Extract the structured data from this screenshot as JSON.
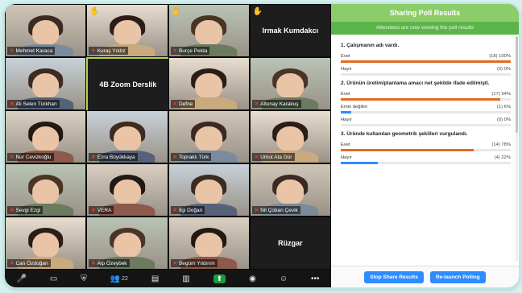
{
  "gallery": {
    "tiles": [
      {
        "name": "Mehmet Karaca",
        "muted": true,
        "hand": false,
        "kind": "video"
      },
      {
        "name": "Kuraş Yıldız",
        "muted": true,
        "hand": true,
        "kind": "video"
      },
      {
        "name": "Burçe Pelda",
        "muted": true,
        "hand": true,
        "kind": "video"
      },
      {
        "name": "Irmak Kumdakcı",
        "muted": true,
        "hand": true,
        "kind": "text"
      },
      {
        "name": "Ali Selen Türkhan",
        "muted": true,
        "hand": false,
        "kind": "video"
      },
      {
        "name": "4B Zoom Derslik",
        "muted": false,
        "hand": false,
        "kind": "text"
      },
      {
        "name": "Defne",
        "muted": true,
        "hand": false,
        "kind": "video"
      },
      {
        "name": "Altunay Karakuş",
        "muted": true,
        "hand": false,
        "kind": "video"
      },
      {
        "name": "Nur Cevizkoğlu",
        "muted": true,
        "hand": false,
        "kind": "video"
      },
      {
        "name": "Ezra Büyükkaya",
        "muted": true,
        "hand": false,
        "kind": "video"
      },
      {
        "name": "Topraklı Türk",
        "muted": true,
        "hand": false,
        "kind": "video"
      },
      {
        "name": "Umut Ata Gür",
        "muted": true,
        "hand": false,
        "kind": "video"
      },
      {
        "name": "Sevgi Ezgi",
        "muted": true,
        "hand": false,
        "kind": "video"
      },
      {
        "name": "VERA",
        "muted": true,
        "hand": false,
        "kind": "video"
      },
      {
        "name": "Ilgi Doğan",
        "muted": true,
        "hand": false,
        "kind": "video"
      },
      {
        "name": "Nil Çoban Çevik",
        "muted": true,
        "hand": false,
        "kind": "video"
      },
      {
        "name": "Can Özdoğan",
        "muted": true,
        "hand": false,
        "kind": "video"
      },
      {
        "name": "Alp Özeybek",
        "muted": true,
        "hand": false,
        "kind": "video"
      },
      {
        "name": "Begüm Yıldırım",
        "muted": true,
        "hand": false,
        "kind": "video"
      },
      {
        "name": "Rüzgar",
        "muted": true,
        "hand": false,
        "kind": "text"
      }
    ]
  },
  "toolbar": {
    "participants_count": "22"
  },
  "poll": {
    "title": "Sharing Poll Results",
    "subtitle": "Attendees are now viewing the poll results",
    "questions": [
      {
        "title": "1. Çalışmanın adı vardı.",
        "answers": [
          {
            "label": "Evet",
            "count": "(18) 100%",
            "fraction": 1.0
          },
          {
            "label": "Hayır",
            "count": "(0) 0%",
            "fraction": 0.0
          }
        ]
      },
      {
        "title": "2. Ürünün üretim/planlama amacı net şekilde ifade edilmişti.",
        "answers": [
          {
            "label": "Evet",
            "count": "(17) 94%",
            "fraction": 0.94
          },
          {
            "label": "Emin değilim",
            "count": "(1) 6%",
            "fraction": 0.06
          },
          {
            "label": "Hayır",
            "count": "(0) 0%",
            "fraction": 0.0
          }
        ]
      },
      {
        "title": "3. Üründe kullanılan geometrik şekilleri vurgulandı.",
        "answers": [
          {
            "label": "Evet",
            "count": "(14) 78%",
            "fraction": 0.78
          },
          {
            "label": "Hayır",
            "count": "(4) 22%",
            "fraction": 0.22
          }
        ]
      }
    ],
    "stop_button": "Stop Share Results",
    "relaunch_button": "Re-launch Polling"
  },
  "colors": {
    "accent_blue": "#2d8cff",
    "bar_orange": "#e36b22",
    "header_green": "#8ccd6a"
  }
}
